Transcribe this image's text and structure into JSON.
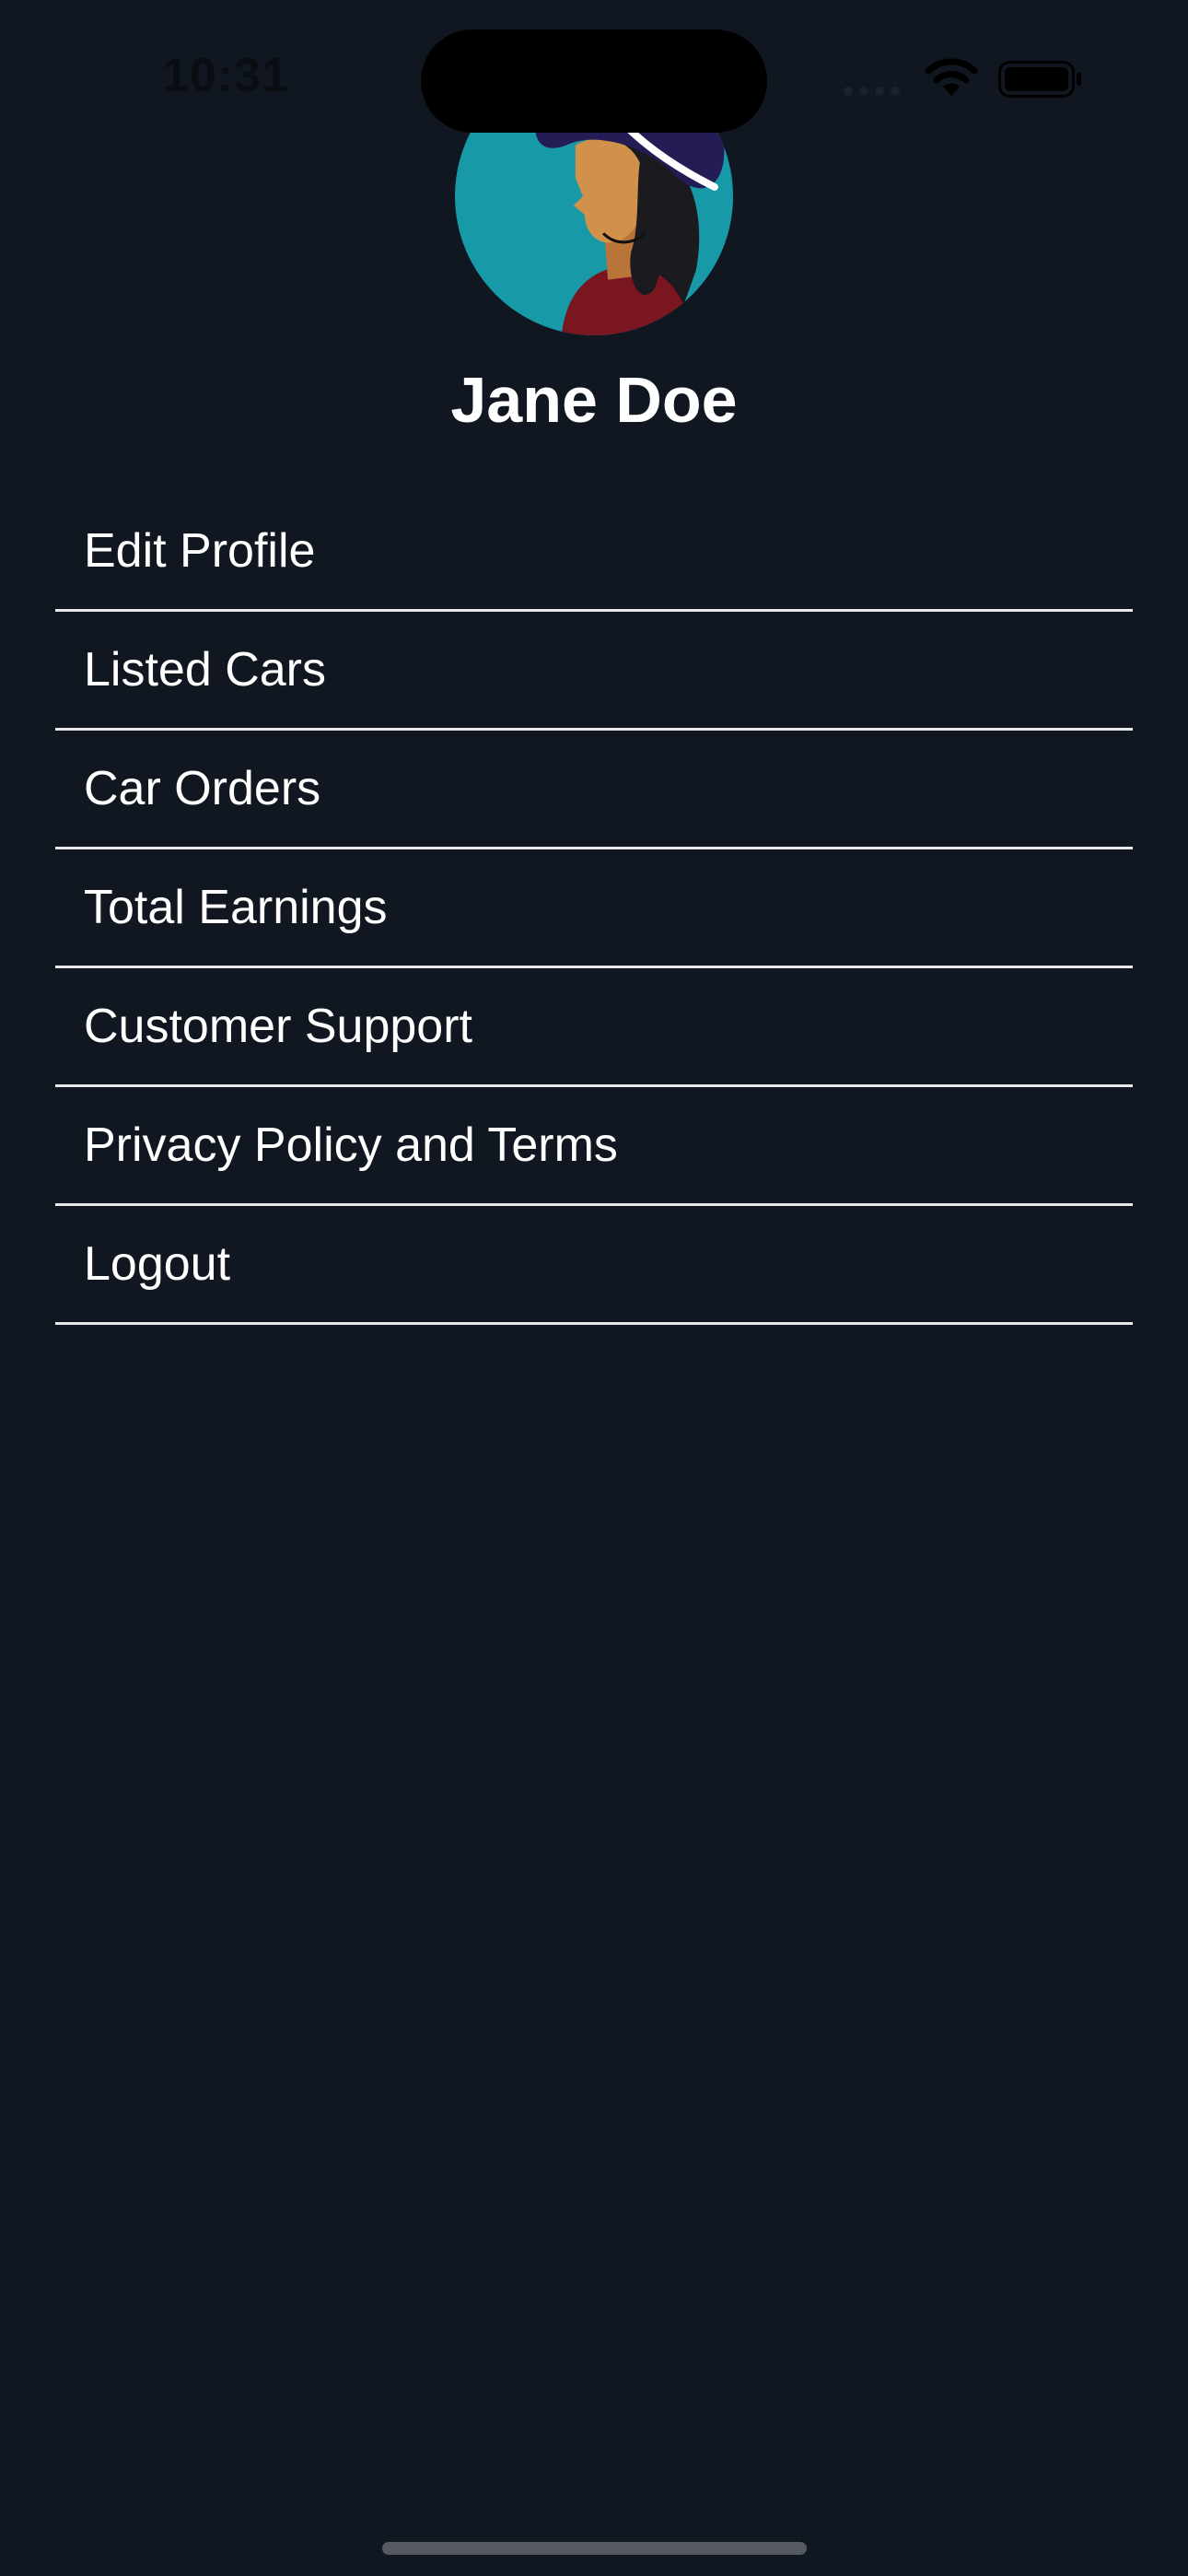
{
  "status_bar": {
    "time": "10:31",
    "icons": [
      "signal-icon",
      "wifi-icon",
      "battery-icon"
    ]
  },
  "profile": {
    "name": "Jane Doe",
    "avatar_icon": "avatar-woman-hat-icon"
  },
  "menu": {
    "items": [
      {
        "label": "Edit Profile"
      },
      {
        "label": "Listed Cars"
      },
      {
        "label": "Car Orders"
      },
      {
        "label": "Total Earnings"
      },
      {
        "label": "Customer Support"
      },
      {
        "label": "Privacy Policy and Terms"
      },
      {
        "label": "Logout"
      }
    ]
  },
  "colors": {
    "background": "#111720",
    "text": "#ffffff",
    "divider": "#e8e8e8",
    "avatar_bg": "#1899a8",
    "hat": "#231c55"
  }
}
